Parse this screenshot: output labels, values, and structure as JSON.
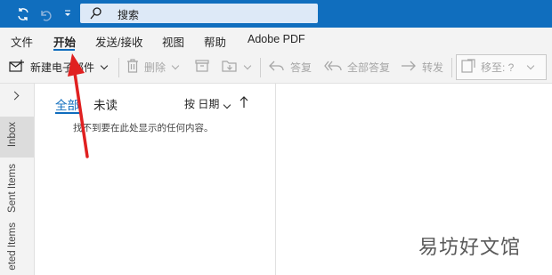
{
  "titlebar": {
    "search_placeholder": "搜索",
    "icons": [
      "sync-icon",
      "undo-icon",
      "quick-access-dropdown-icon",
      "search-icon"
    ]
  },
  "menu": {
    "items": [
      "文件",
      "开始",
      "发送/接收",
      "视图",
      "帮助",
      "Adobe PDF"
    ],
    "active": "开始"
  },
  "ribbon": {
    "new_email": "新建电子邮件",
    "delete": "删除",
    "reply": "答复",
    "reply_all": "全部答复",
    "forward": "转发",
    "move_to": "移至: ?"
  },
  "folders": {
    "inbox": "Inbox",
    "sent": "Sent Items",
    "deleted": "eted Items"
  },
  "message_list": {
    "tab_all": "全部",
    "tab_unread": "未读",
    "sort_label": "按 日期",
    "empty_text": "找不到要在此处显示的任何内容。"
  },
  "watermark": "易坊好文馆",
  "colors": {
    "titlebar": "#106ebe",
    "accent": "#0f6cbd",
    "annotation_arrow": "#e02020"
  }
}
